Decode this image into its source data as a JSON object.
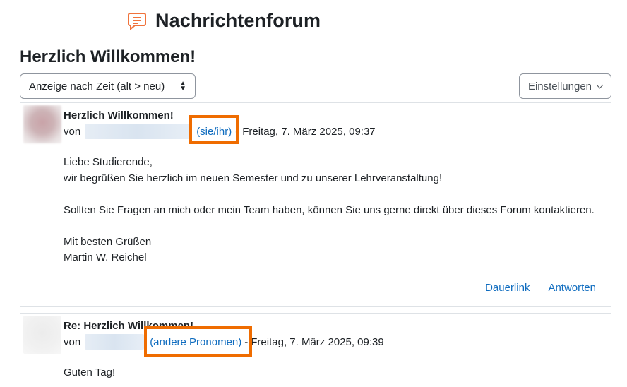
{
  "header": {
    "forum_title": "Nachrichtenforum",
    "icon": "chat-bubble-icon",
    "accent_color": "#f0733c"
  },
  "discussion": {
    "title": "Herzlich Willkommen!"
  },
  "controls": {
    "sort_value": "Anzeige nach Zeit (alt > neu)",
    "settings_label": "Einstellungen"
  },
  "posts": [
    {
      "subject": "Herzlich Willkommen!",
      "by": "von",
      "pronoun": "(sie/ihr)",
      "separator": "-",
      "date": "Freitag, 7. März 2025, 09:37",
      "body": [
        "Liebe Studierende,",
        "wir begrüßen Sie herzlich im neuen Semester und zu unserer Lehrveranstaltung!",
        "",
        "Sollten Sie Fragen an mich oder mein Team haben, können Sie uns gerne direkt über dieses Forum kontaktieren.",
        "",
        "Mit besten Grüßen",
        "Martin W. Reichel"
      ],
      "actions": {
        "permalink": "Dauerlink",
        "reply": "Antworten"
      }
    },
    {
      "subject": "Re: Herzlich Willkommen!",
      "by": "von",
      "pronoun": "(andere Pronomen)",
      "separator": "-",
      "date": "Freitag, 7. März 2025, 09:39",
      "body": [
        "Guten Tag!"
      ]
    }
  ],
  "highlight_color": "#ef6c00"
}
